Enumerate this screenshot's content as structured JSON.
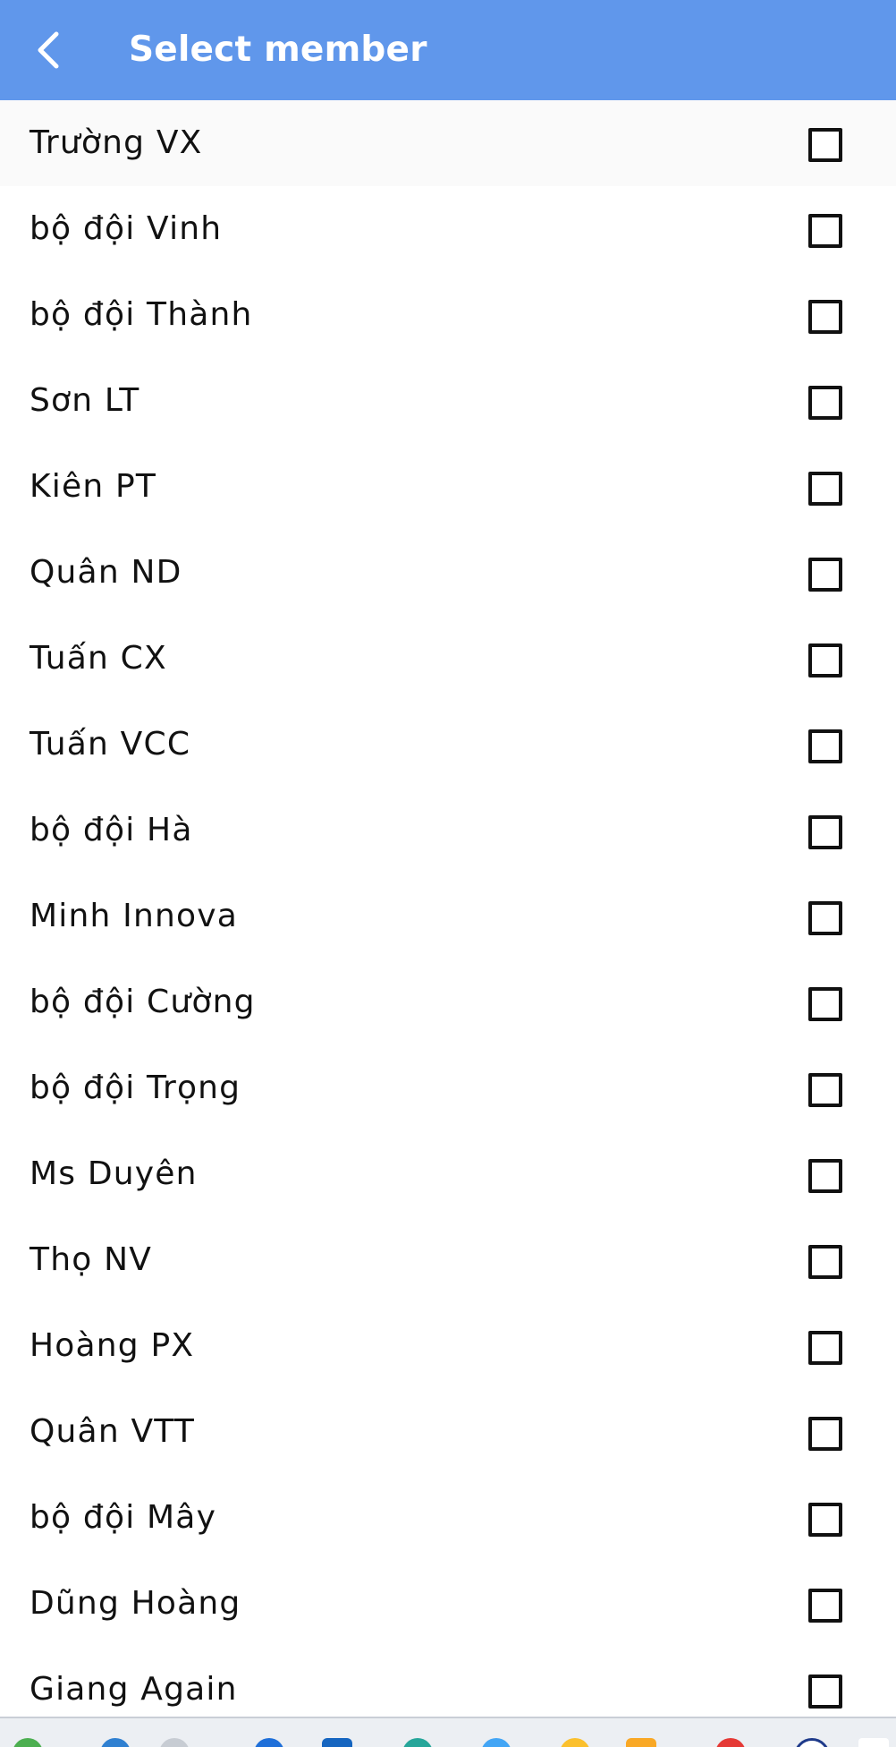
{
  "header": {
    "back_icon": "chevron-left-icon",
    "title": "Select member",
    "background_color": "#6097eb"
  },
  "members": [
    {
      "name": "Trường VX",
      "checked": false
    },
    {
      "name": "bộ đội Vinh",
      "checked": false
    },
    {
      "name": "bộ đội Thành",
      "checked": false
    },
    {
      "name": "Sơn LT",
      "checked": false
    },
    {
      "name": "Kiên PT",
      "checked": false
    },
    {
      "name": "Quân ND",
      "checked": false
    },
    {
      "name": "Tuấn CX",
      "checked": false
    },
    {
      "name": "Tuấn VCC",
      "checked": false
    },
    {
      "name": "bộ đội Hà",
      "checked": false
    },
    {
      "name": "Minh Innova",
      "checked": false
    },
    {
      "name": "bộ đội Cường",
      "checked": false
    },
    {
      "name": "bộ đội Trọng",
      "checked": false
    },
    {
      "name": "Ms Duyên",
      "checked": false
    },
    {
      "name": "Thọ NV",
      "checked": false
    },
    {
      "name": "Hoàng PX",
      "checked": false
    },
    {
      "name": "Quân VTT",
      "checked": false
    },
    {
      "name": "bộ đội Mây",
      "checked": false
    },
    {
      "name": "Dũng Hoàng",
      "checked": false
    },
    {
      "name": "Giang Again",
      "checked": false
    }
  ]
}
